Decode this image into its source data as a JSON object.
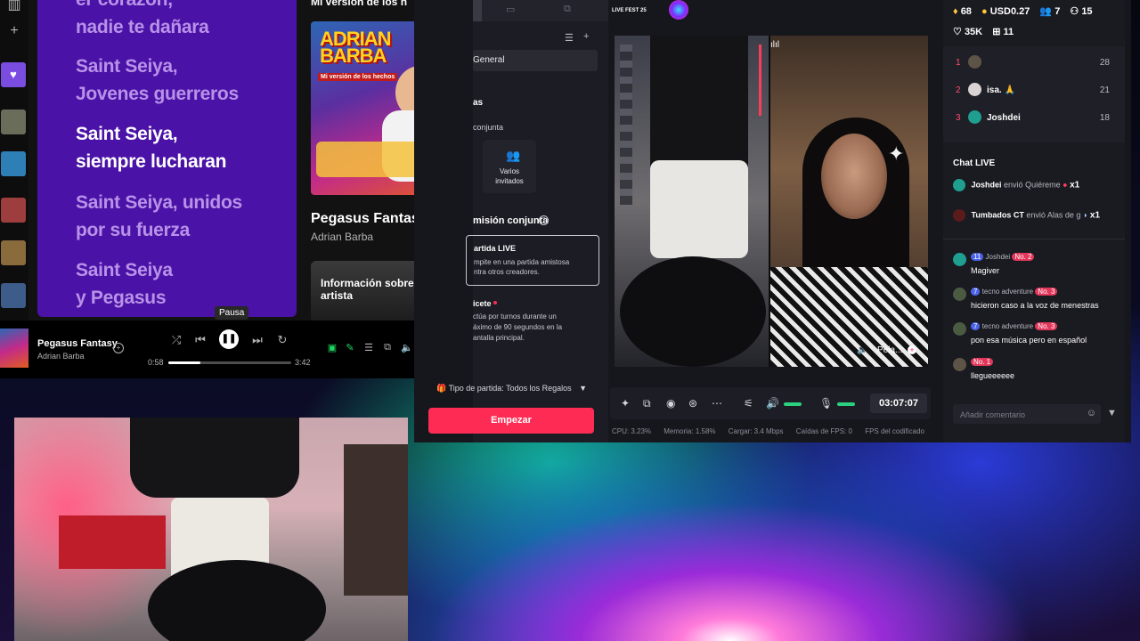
{
  "spotify": {
    "lyrics": [
      {
        "text": "er corazón, nadie te dañara",
        "active": false
      },
      {
        "text": "Saint Seiya, Jovenes guerreros",
        "active": false
      },
      {
        "text": "Saint Seiya, siempre lucharan",
        "active": true
      },
      {
        "text": "Saint Seiya, unidos por su fuerza",
        "active": false
      },
      {
        "text": "Saint Seiya y Pegasus",
        "active": false
      }
    ],
    "lyrics_lines": {
      "l0a": "er corazón,",
      "l0b": "nadie te dañara",
      "l1a": "Saint Seiya,",
      "l1b": "Jovenes guerreros",
      "l2a": "Saint Seiya,",
      "l2b": "siempre lucharan",
      "l3a": "Saint Seiya, unidos",
      "l3b": "por su fuerza",
      "l4a": "Saint Seiya",
      "l4b": "y Pegasus"
    },
    "side": {
      "header": "Mi versión de los h",
      "cover_title_1": "ADRIAN",
      "cover_title_2": "BARBA",
      "cover_subtitle": "Mi versión de los hechos",
      "song": "Pegasus Fantasy",
      "artist": "Adrian Barba",
      "artist_card": "Información sobre el artista"
    },
    "player": {
      "title": "Pegasus Fantasy",
      "artist": "Adrian Barba",
      "elapsed": "0:58",
      "total": "3:42",
      "progress_fraction": 0.26,
      "tooltip": "Pausa"
    }
  },
  "studio": {
    "left": {
      "general": "General",
      "section_partial": "as",
      "conjunta": "conjunta",
      "invited_1": "Varios",
      "invited_2": "invitados",
      "mision": "misión conjunta",
      "partida_title": "artida LIVE",
      "partida_desc_1": "mpite en una partida amistosa",
      "partida_desc_2": "ntra otros creadores.",
      "icete": "icete",
      "icete_desc_1": "ctúa por turnos durante un",
      "icete_desc_2": "áximo de 90 segundos en la",
      "icete_desc_3": "antalla principal.",
      "match_type": "Tipo de partida: Todos los Regalos",
      "start": "Empezar"
    },
    "preview": {
      "badge": "LIVE FEST 25",
      "name": "Pela..."
    },
    "controls": {
      "timer": "03:07:07"
    },
    "status": {
      "cpu": "CPU: 3.23%",
      "memory": "Memoria: 1.58%",
      "upload": "Cargar: 3.4 Mbps",
      "fps_drops": "Caídas de FPS: 0",
      "fps_encoder": "FPS del codificado"
    },
    "stats": {
      "diamonds": "68",
      "usd": "USD0.27",
      "viewers": "7",
      "new": "15",
      "likes": "35K",
      "gifts": "11"
    },
    "ranking": [
      {
        "rank": "1",
        "name": "",
        "score": "28"
      },
      {
        "rank": "2",
        "name": "isa. 🙏",
        "score": "21"
      },
      {
        "rank": "3",
        "name": "Joshdei",
        "score": "18"
      }
    ],
    "chat": {
      "title": "Chat LIVE",
      "gifts": [
        {
          "who": "Joshdei",
          "verb": "envió Quiéreme",
          "qty": "x1"
        },
        {
          "who": "Tumbados CT",
          "verb": "envió Alas de g",
          "qty": "x1"
        }
      ],
      "messages": [
        {
          "level": "11",
          "user": "Joshdei",
          "badge": "No. 2",
          "text": "Magiver"
        },
        {
          "level": "7",
          "user": "tecno adventure",
          "badge": "No. 3",
          "text": "hicieron caso a la voz de menestras"
        },
        {
          "level": "7",
          "user": "tecno adventure",
          "badge": "No. 3",
          "text": "pon esa música pero en español"
        },
        {
          "level": "",
          "user": "",
          "badge": "No. 1",
          "text": "llegueeeeee"
        }
      ],
      "comment_placeholder": "Añadir comentario"
    }
  }
}
